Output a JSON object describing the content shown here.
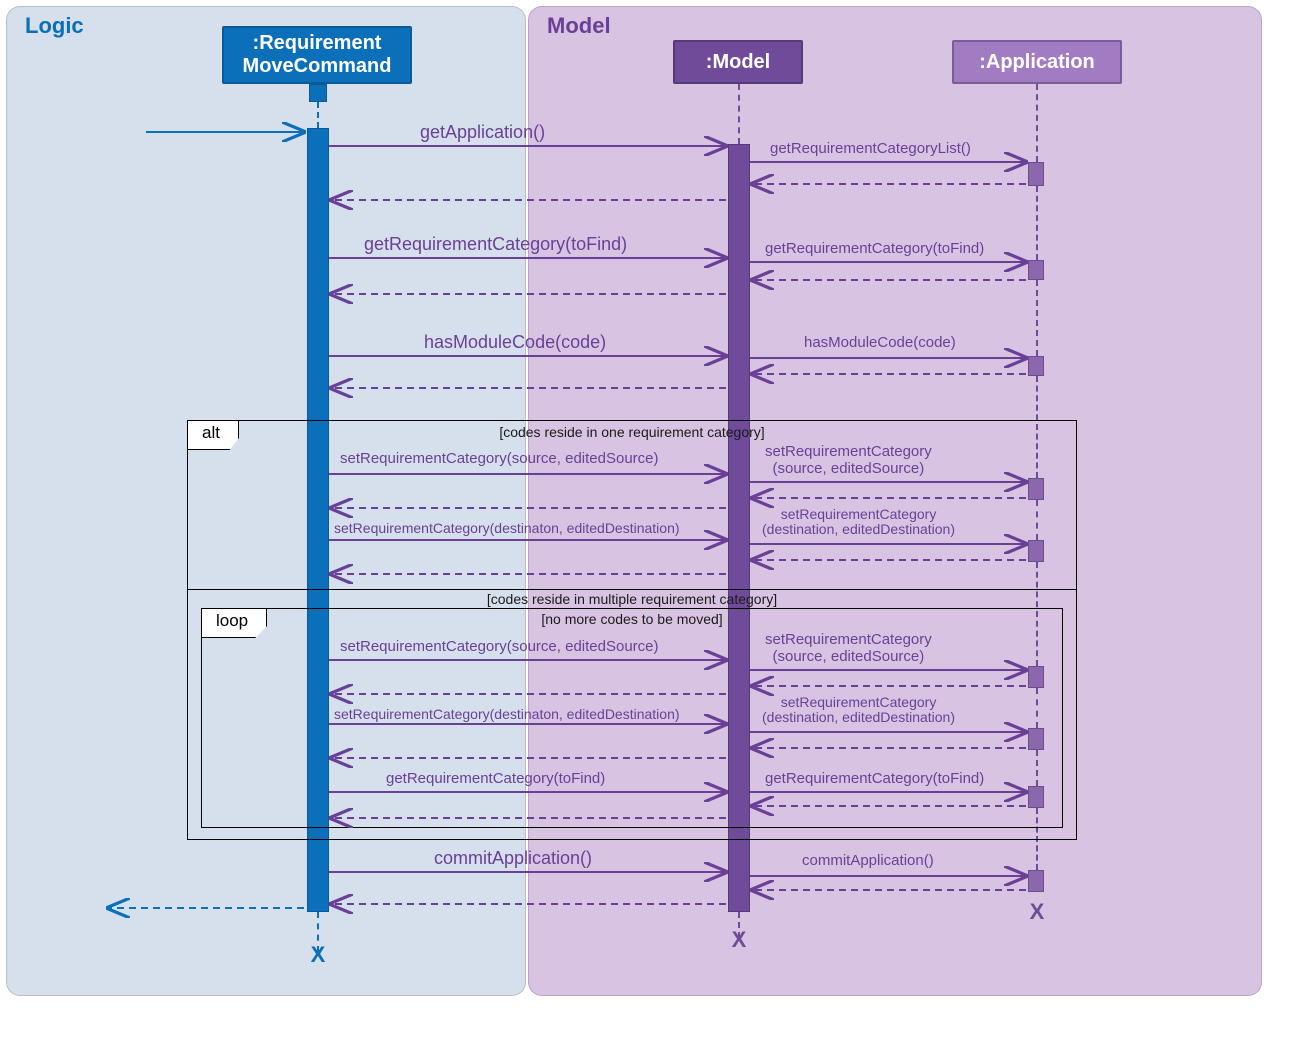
{
  "panels": {
    "logic_title": "Logic",
    "model_title": "Model"
  },
  "participants": {
    "requirement_move_command": ":Requirement\nMoveCommand",
    "model": ":Model",
    "application": ":Application"
  },
  "messages": {
    "m1_rc_model": "getApplication()",
    "m1_model_app": "getRequirementCategoryList()",
    "m2_rc_model": "getRequirementCategory(toFind)",
    "m2_model_app": "getRequirementCategory(toFind)",
    "m3_rc_model": "hasModuleCode(code)",
    "m3_model_app": "hasModuleCode(code)",
    "alt_label": "alt",
    "alt_guard1": "[codes reside in one requirement category]",
    "alt_guard2": "[codes reside in multiple requirement category]",
    "loop_label": "loop",
    "loop_guard": "[no more codes to be moved]",
    "m4_rc_model": "setRequirementCategory(source, editedSource)",
    "m4_model_app_l1": "setRequirementCategory",
    "m4_model_app_l2": "(source, editedSource)",
    "m5_rc_model": "setRequirementCategory(destinaton, editedDestination)",
    "m5_model_app_l1": "setRequirementCategory",
    "m5_model_app_l2": "(destination, editedDestination)",
    "m6_rc_model": "setRequirementCategory(source, editedSource)",
    "m6_model_app_l1": "setRequirementCategory",
    "m6_model_app_l2": "(source, editedSource)",
    "m7_rc_model": "setRequirementCategory(destinaton, editedDestination)",
    "m7_model_app_l1": "setRequirementCategory",
    "m7_model_app_l2": "(destination, editedDestination)",
    "m8_rc_model": "getRequirementCategory(toFind)",
    "m8_model_app": "getRequirementCategory(toFind)",
    "m9_rc_model": "commitApplication()",
    "m9_model_app": "commitApplication()"
  },
  "colors": {
    "logic_blue": "#0b6fb9",
    "model_purple": "#6f4b99",
    "model_purple_mid": "#8b68ad"
  }
}
